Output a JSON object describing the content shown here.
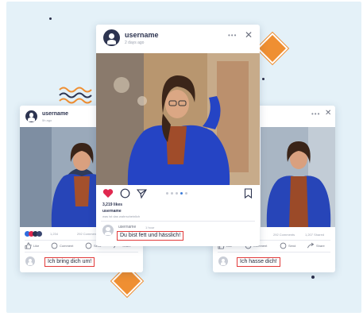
{
  "colors": {
    "background": "#e4f1f8",
    "accent_orange": "#ef8f32",
    "dark_navy": "#2d3450",
    "like_red": "#e0284f",
    "highlight_red": "#e23a3a"
  },
  "center_post": {
    "username": "username",
    "time_ago": "2 days ago",
    "likes": "3,219 likes",
    "caption_user": "username",
    "caption_text": "was ist das wahrscheinlich",
    "commenter": "username",
    "comment_time": "1 hour",
    "comment": "Du bist fett und hässlich!",
    "icons": [
      "heart-icon",
      "comment-icon",
      "send-icon",
      "bookmark-icon",
      "more-icon",
      "close-icon"
    ]
  },
  "left_post": {
    "username": "username",
    "time_ago": "5h ago",
    "reactions_count": "1,234",
    "comments_count": "292 Comments",
    "action_like": "Like",
    "action_comment": "Comment",
    "action_send": "Send",
    "action_share": "Share",
    "comment": "Ich bring dich um!"
  },
  "right_post": {
    "comments_count": "292 Comments",
    "shares_count": "1,207 Shared",
    "action_like": "Like",
    "action_comment": "Comment",
    "action_send": "Send",
    "action_share": "Share",
    "comment": "Ich hasse dich!"
  }
}
